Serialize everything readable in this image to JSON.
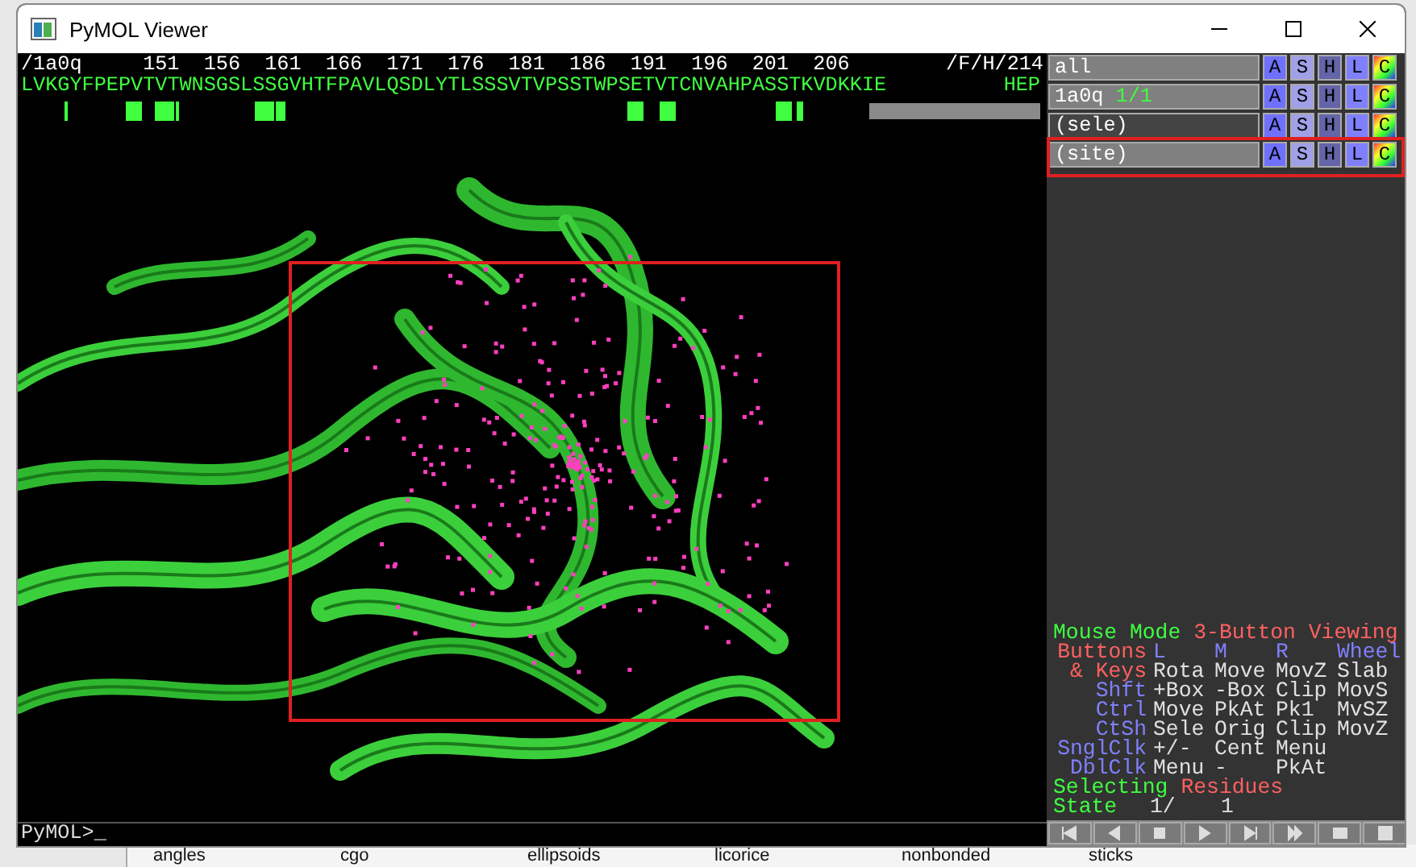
{
  "window": {
    "title": "PyMOL Viewer"
  },
  "sequence": {
    "object": "/1a0q",
    "ruler": [
      "151",
      "156",
      "161",
      "166",
      "171",
      "176",
      "181",
      "186",
      "191",
      "196",
      "201",
      "206"
    ],
    "chain": "/F/H/214",
    "residues": "LVKGYFPEPVTVTWNSGSLSSGVHTFPAVLQSDLYTLSSSVTVPSSTWPSETVTCNVAHPASSTKVDKKIE",
    "tail": "HEP"
  },
  "objects": [
    {
      "name": "all",
      "enabled": true,
      "buttons": [
        "A",
        "S",
        "H",
        "L",
        "C"
      ]
    },
    {
      "name": "1a0q",
      "state": "1/1",
      "enabled": true,
      "buttons": [
        "A",
        "S",
        "H",
        "L",
        "C"
      ]
    },
    {
      "name": "(sele)",
      "enabled": false,
      "buttons": [
        "A",
        "S",
        "H",
        "L",
        "C"
      ]
    },
    {
      "name": "(site)",
      "enabled": true,
      "buttons": [
        "A",
        "S",
        "H",
        "L",
        "C"
      ]
    }
  ],
  "mouse_panel": [
    {
      "kind": "line",
      "parts": [
        {
          "text": "Mouse Mode",
          "color": "#40ff40"
        },
        {
          "text": "3-Button Viewing",
          "color": "#ff6060"
        }
      ]
    },
    {
      "kind": "grid",
      "cells": [
        {
          "text": "Buttons",
          "color": "#ff6060"
        },
        {
          "text": "L",
          "color": "#8080ff"
        },
        {
          "text": "M",
          "color": "#8080ff"
        },
        {
          "text": "R",
          "color": "#8080ff"
        },
        {
          "text": "Wheel",
          "color": "#8080ff"
        }
      ]
    },
    {
      "kind": "grid",
      "cells": [
        {
          "text": "& Keys",
          "color": "#ff6060"
        },
        {
          "text": "Rota",
          "color": "#e0e0e0"
        },
        {
          "text": "Move",
          "color": "#e0e0e0"
        },
        {
          "text": "MovZ",
          "color": "#e0e0e0"
        },
        {
          "text": "Slab",
          "color": "#e0e0e0"
        }
      ]
    },
    {
      "kind": "grid",
      "cells": [
        {
          "text": "Shft",
          "color": "#8080ff"
        },
        {
          "text": "+Box",
          "color": "#e0e0e0"
        },
        {
          "text": "-Box",
          "color": "#e0e0e0"
        },
        {
          "text": "Clip",
          "color": "#e0e0e0"
        },
        {
          "text": "MovS",
          "color": "#e0e0e0"
        }
      ]
    },
    {
      "kind": "grid",
      "cells": [
        {
          "text": "Ctrl",
          "color": "#8080ff"
        },
        {
          "text": "Move",
          "color": "#e0e0e0"
        },
        {
          "text": "PkAt",
          "color": "#e0e0e0"
        },
        {
          "text": "Pk1",
          "color": "#e0e0e0"
        },
        {
          "text": "MvSZ",
          "color": "#e0e0e0"
        }
      ]
    },
    {
      "kind": "grid",
      "cells": [
        {
          "text": "CtSh",
          "color": "#8080ff"
        },
        {
          "text": "Sele",
          "color": "#e0e0e0"
        },
        {
          "text": "Orig",
          "color": "#e0e0e0"
        },
        {
          "text": "Clip",
          "color": "#e0e0e0"
        },
        {
          "text": "MovZ",
          "color": "#e0e0e0"
        }
      ]
    },
    {
      "kind": "grid",
      "cells": [
        {
          "text": "SnglClk",
          "color": "#8080ff"
        },
        {
          "text": "+/-",
          "color": "#e0e0e0"
        },
        {
          "text": "Cent",
          "color": "#e0e0e0"
        },
        {
          "text": "Menu",
          "color": "#e0e0e0"
        }
      ]
    },
    {
      "kind": "grid",
      "cells": [
        {
          "text": "DblClk",
          "color": "#8080ff"
        },
        {
          "text": "Menu",
          "color": "#e0e0e0"
        },
        {
          "text": "-",
          "color": "#e0e0e0"
        },
        {
          "text": "PkAt",
          "color": "#e0e0e0"
        }
      ]
    },
    {
      "kind": "line",
      "parts": [
        {
          "text": "Selecting",
          "color": "#40ff40"
        },
        {
          "text": "Residues",
          "color": "#ff6060"
        }
      ]
    },
    {
      "kind": "state",
      "cells": [
        {
          "text": "State",
          "color": "#40ff40"
        },
        {
          "text": "1/",
          "color": "#e0e0e0"
        },
        {
          "text": "1",
          "color": "#e0e0e0"
        }
      ]
    }
  ],
  "command_line": {
    "prompt": "PyMOL>_"
  },
  "background_window": {
    "labels": [
      "angles",
      "cgo",
      "ellipsoids",
      "licorice",
      "nonbonded",
      "sticks"
    ]
  }
}
